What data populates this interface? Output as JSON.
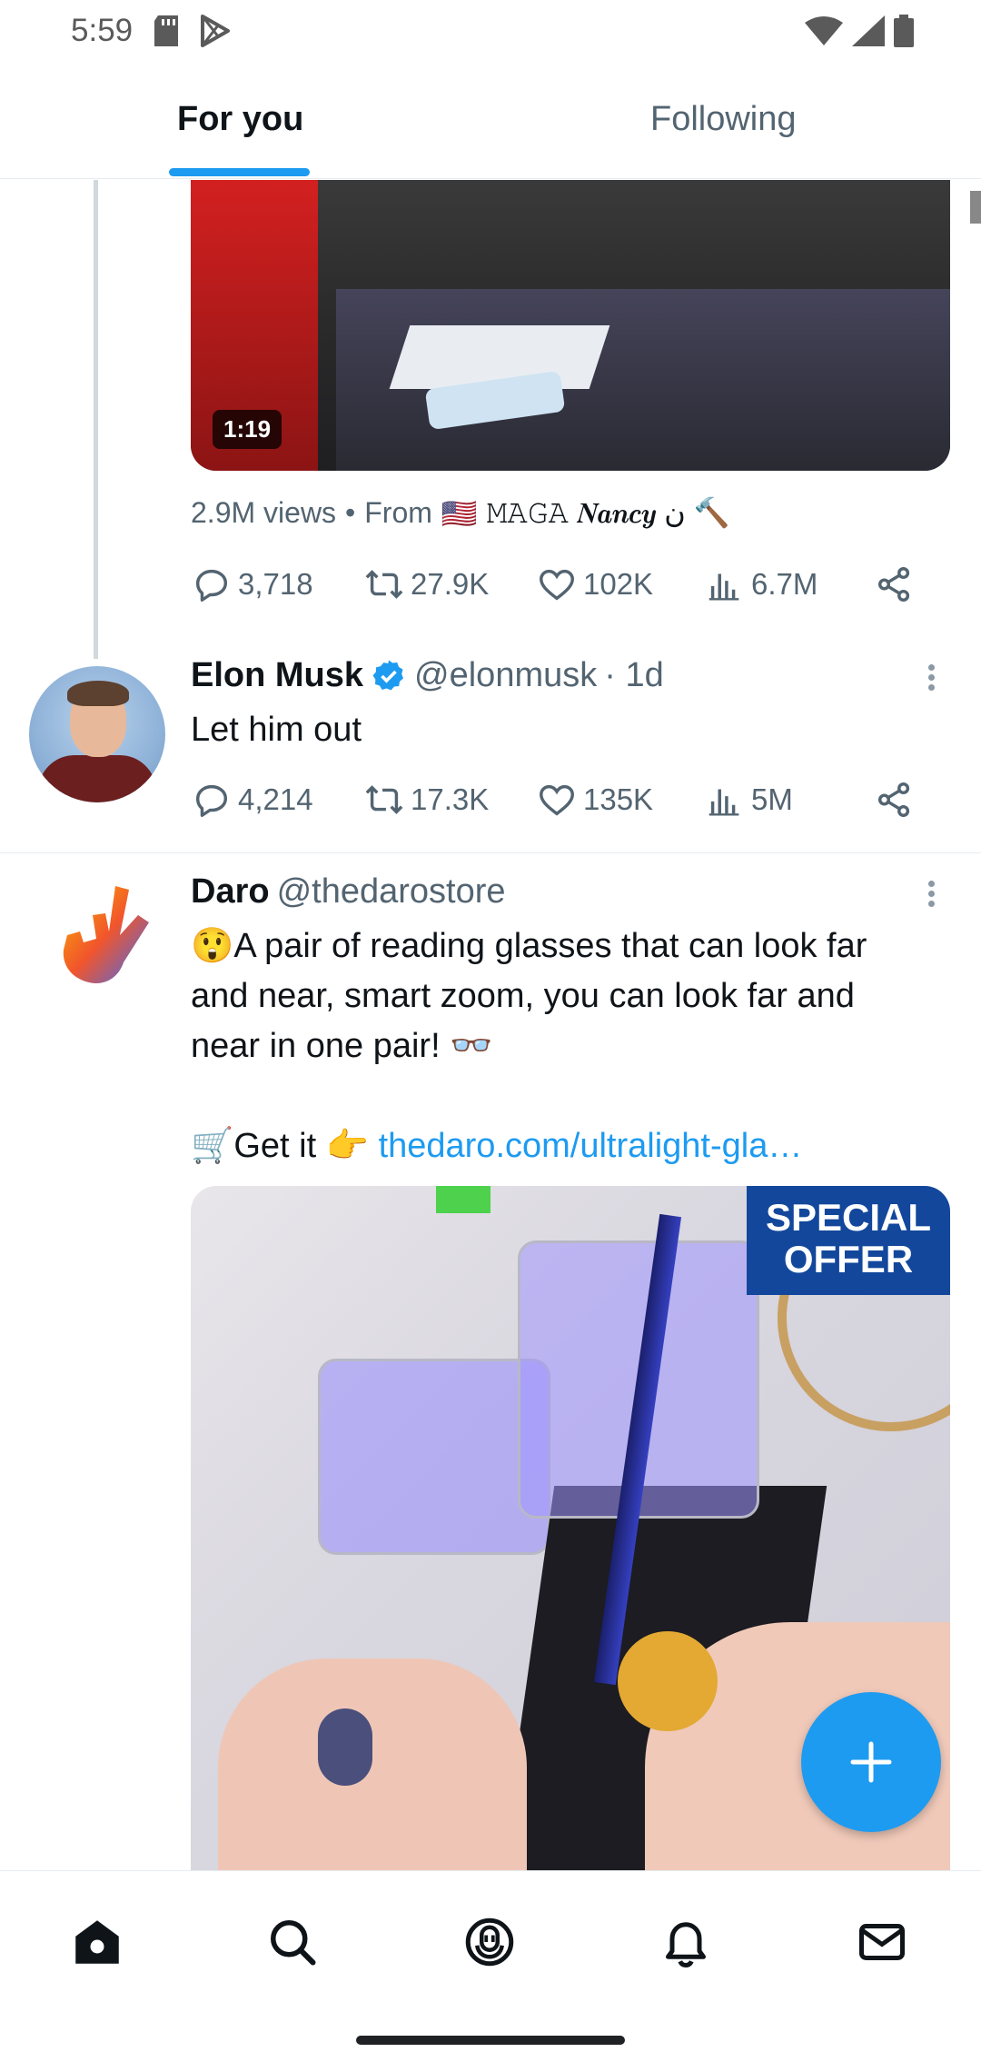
{
  "status_bar": {
    "time": "5:59"
  },
  "tabs": {
    "for_you": "For you",
    "following": "Following"
  },
  "tweet_prev": {
    "video_duration": "1:19",
    "views": "2.9M views",
    "separator": "•",
    "from_label": "From",
    "from_flag": "🇺🇸",
    "from_name": "𝙼𝙰𝙶𝙰 𝑵𝒂𝒏𝒄𝒚 ن 🔨",
    "reply_count": "3,718",
    "retweet_count": "27.9K",
    "like_count": "102K",
    "view_count": "6.7M"
  },
  "tweet_elon": {
    "name": "Elon Musk",
    "handle": "@elonmusk",
    "time": "· 1d",
    "text": "Let him out",
    "reply_count": "4,214",
    "retweet_count": "17.3K",
    "like_count": "135K",
    "view_count": "5M"
  },
  "tweet_daro": {
    "name": "Daro",
    "handle": "@thedarostore",
    "text_line1": "😲A pair of reading glasses that can look far",
    "text_line2": "and near, smart zoom, you can look far and",
    "text_line3": "near in one pair! 👓",
    "cta_prefix": "🛒Get it 👉",
    "cta_link": "thedaro.com/ultralight-gla…",
    "badge_line1": "SPECIAL",
    "badge_line2": "OFFER"
  },
  "colors": {
    "accent": "#1d9bf0",
    "text_secondary": "#536471",
    "verified": "#1d9bf0"
  },
  "icons": {
    "nav": [
      "home-icon",
      "search-icon",
      "spaces-icon",
      "notifications-icon",
      "messages-icon"
    ],
    "fab": "compose-plus-icon"
  }
}
